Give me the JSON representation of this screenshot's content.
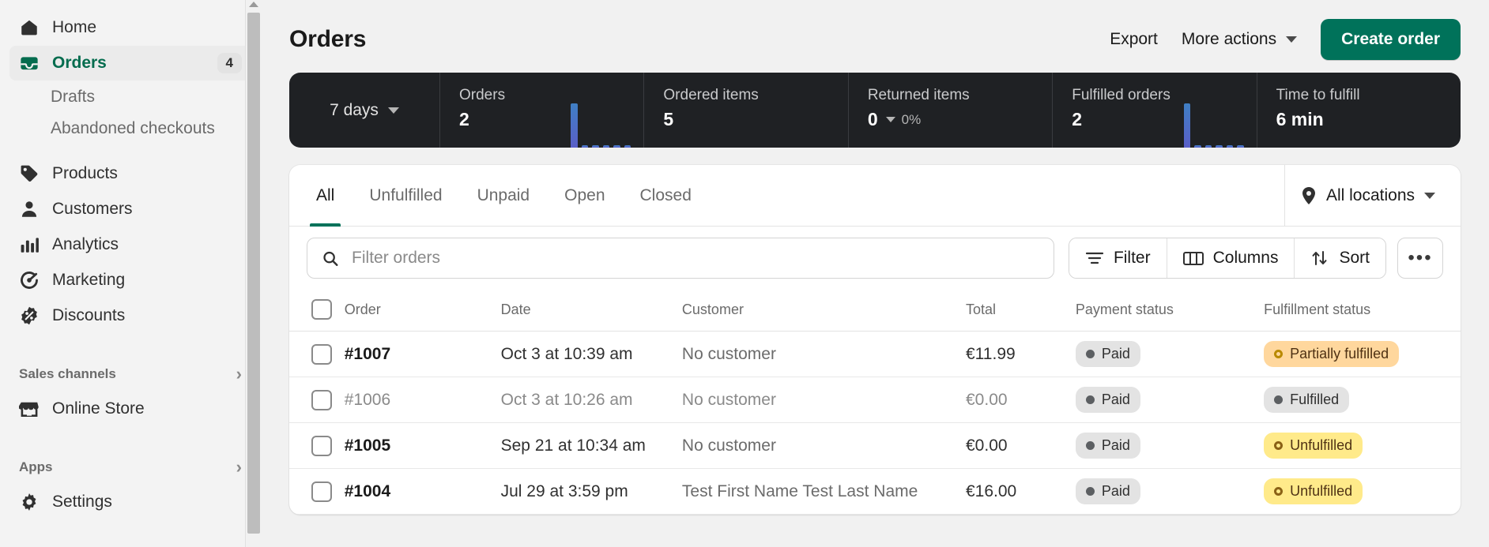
{
  "sidebar": {
    "items": [
      {
        "label": "Home",
        "icon": "home-icon",
        "type": "nav",
        "active": false
      },
      {
        "label": "Orders",
        "icon": "orders-icon",
        "type": "nav",
        "active": true,
        "badge": "4"
      },
      {
        "label": "Drafts",
        "type": "sub"
      },
      {
        "label": "Abandoned checkouts",
        "type": "sub"
      },
      {
        "label": "Products",
        "icon": "products-tag-icon",
        "type": "nav",
        "active": false
      },
      {
        "label": "Customers",
        "icon": "customers-icon",
        "type": "nav",
        "active": false
      },
      {
        "label": "Analytics",
        "icon": "analytics-bars-icon",
        "type": "nav",
        "active": false
      },
      {
        "label": "Marketing",
        "icon": "marketing-icon",
        "type": "nav",
        "active": false
      },
      {
        "label": "Discounts",
        "icon": "discounts-icon",
        "type": "nav",
        "active": false
      },
      {
        "label": "Sales channels",
        "type": "section"
      },
      {
        "label": "Online Store",
        "icon": "online-store-icon",
        "type": "nav",
        "active": false
      },
      {
        "label": "Apps",
        "type": "section"
      },
      {
        "label": "Settings",
        "icon": "gear-icon",
        "type": "nav",
        "active": false
      }
    ]
  },
  "header": {
    "title": "Orders",
    "export_label": "Export",
    "more_actions_label": "More actions",
    "create_order_label": "Create order"
  },
  "metrics": {
    "range_label": "7 days",
    "cards": [
      {
        "label": "Orders",
        "value": "2",
        "delta": "",
        "spark": [
          0,
          0,
          0,
          0,
          56,
          3,
          3,
          3,
          3,
          3
        ]
      },
      {
        "label": "Ordered items",
        "value": "5",
        "delta": "",
        "spark": []
      },
      {
        "label": "Returned items",
        "value": "0",
        "delta": "0%",
        "spark": []
      },
      {
        "label": "Fulfilled orders",
        "value": "2",
        "delta": "",
        "spark": [
          0,
          0,
          0,
          0,
          56,
          3,
          3,
          3,
          3,
          3
        ]
      },
      {
        "label": "Time to fulfill",
        "value": "6 min",
        "delta": "",
        "spark": []
      }
    ]
  },
  "tabs": [
    {
      "label": "All",
      "active": true
    },
    {
      "label": "Unfulfilled",
      "active": false
    },
    {
      "label": "Unpaid",
      "active": false
    },
    {
      "label": "Open",
      "active": false
    },
    {
      "label": "Closed",
      "active": false
    }
  ],
  "locations": {
    "label": "All locations"
  },
  "toolbar": {
    "search_placeholder": "Filter orders",
    "search_value": "",
    "filter_label": "Filter",
    "columns_label": "Columns",
    "sort_label": "Sort",
    "more_label": "•••"
  },
  "table": {
    "columns": [
      "Order",
      "Date",
      "Customer",
      "Total",
      "Payment status",
      "Fulfillment status"
    ],
    "rows": [
      {
        "order": "#1007",
        "date": "Oct 3 at 10:39 am",
        "customer": "No customer",
        "total": "€11.99",
        "payment": "Paid",
        "payment_tone": "grey",
        "fulfillment": "Partially fulfilled",
        "fulfillment_tone": "orange",
        "read": false
      },
      {
        "order": "#1006",
        "date": "Oct 3 at 10:26 am",
        "customer": "No customer",
        "total": "€0.00",
        "payment": "Paid",
        "payment_tone": "grey",
        "fulfillment": "Fulfilled",
        "fulfillment_tone": "grey",
        "read": true
      },
      {
        "order": "#1005",
        "date": "Sep 21 at 10:34 am",
        "customer": "No customer",
        "total": "€0.00",
        "payment": "Paid",
        "payment_tone": "grey",
        "fulfillment": "Unfulfilled",
        "fulfillment_tone": "yellow",
        "read": false
      },
      {
        "order": "#1004",
        "date": "Jul 29 at 3:59 pm",
        "customer": "Test First Name Test Last Name",
        "total": "€16.00",
        "payment": "Paid",
        "payment_tone": "grey",
        "fulfillment": "Unfulfilled",
        "fulfillment_tone": "yellow",
        "read": false
      }
    ]
  },
  "colors": {
    "brand_green": "#00725a",
    "active_green": "#046c4e",
    "metrics_bg": "#1f2124",
    "spark_blue": "#3f7fc4"
  }
}
